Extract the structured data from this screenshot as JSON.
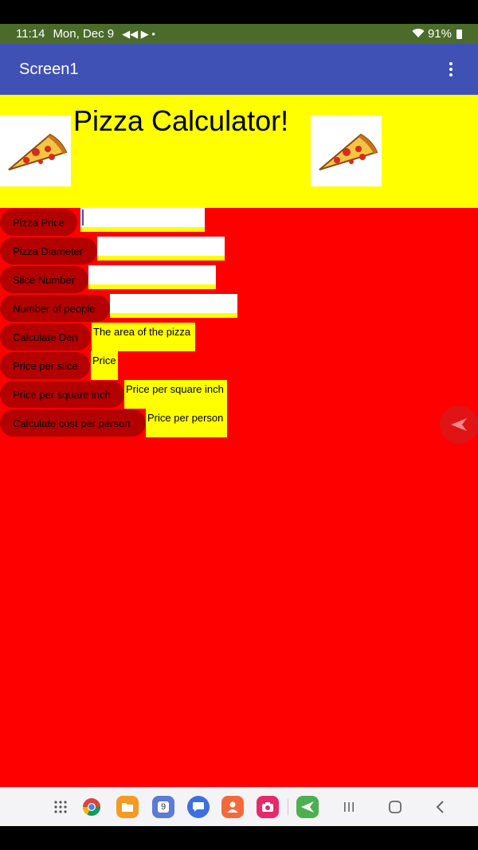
{
  "status_bar": {
    "time": "11:14",
    "date": "Mon, Dec 9",
    "battery": "91%"
  },
  "app_bar": {
    "title": "Screen1"
  },
  "header": {
    "title": "Pizza Calculator!"
  },
  "rows": [
    {
      "button": "Pizza Price"
    },
    {
      "button": "Pizza Diameter"
    },
    {
      "button": "Slice Number"
    },
    {
      "button": "Number of people"
    },
    {
      "button": "Calculate Den",
      "result": "The area of the pizza"
    },
    {
      "button": "Price per slice",
      "result": "Price"
    },
    {
      "button": "Price per square inch",
      "result": "Price per square inch"
    },
    {
      "button": "Calculate cost per person",
      "result": "Price per person"
    }
  ],
  "nav_bar": {
    "apps": [
      "apps-grid-icon",
      "chrome-icon",
      "files-icon",
      "calendar-icon",
      "messages-icon",
      "contacts-icon",
      "camera-icon",
      "send-icon"
    ],
    "calendar_day": "9"
  },
  "colors": {
    "background": "#ff0000",
    "header": "#ffff00",
    "button": "#b30000",
    "app_bar": "#3f51b5",
    "status_bar": "#4a6b2a"
  }
}
